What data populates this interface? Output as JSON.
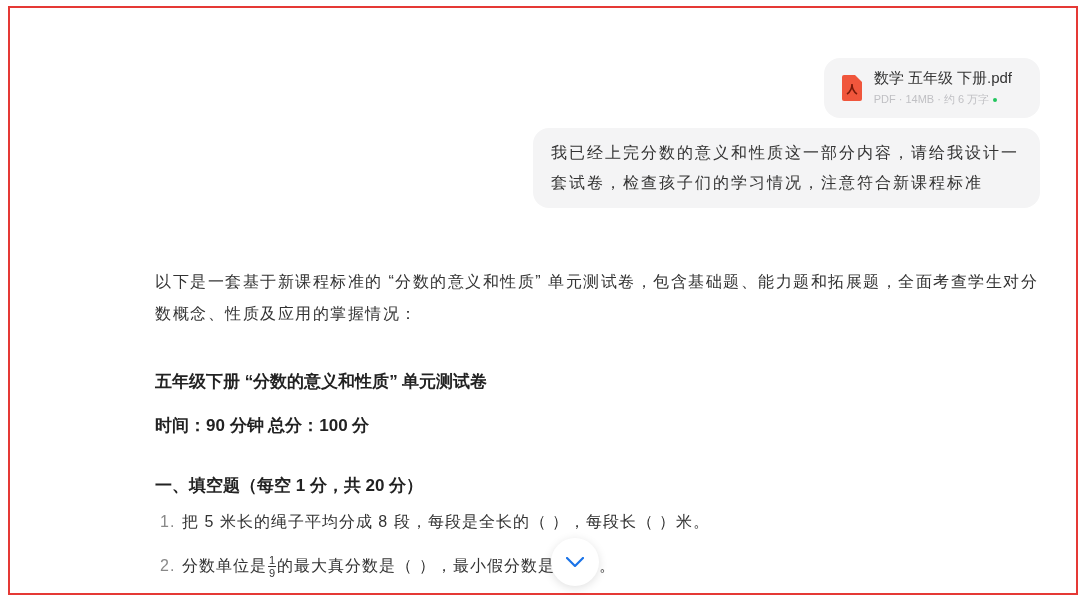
{
  "attachment": {
    "file_name": "数学 五年级 下册.pdf",
    "meta": "PDF · 14MB · 约 6 万字"
  },
  "user_message": "我已经上完分数的意义和性质这一部分内容，请给我设计一套试卷，检查孩子们的学习情况，注意符合新课程标准",
  "reply": {
    "intro": "以下是一套基于新课程标准的 “分数的意义和性质” 单元测试卷，包含基础题、能力题和拓展题，全面考查学生对分数概念、性质及应用的掌握情况：",
    "title": "五年级下册 “分数的意义和性质” 单元测试卷",
    "meta": "时间：90 分钟 总分：100 分",
    "section": "一、填空题（每空 1 分，共 20 分）",
    "items": [
      {
        "number": "1.",
        "before": "把 5 米长的绳子平均分成 8 段，每段是全长的（ ），每段长（ ）米。"
      },
      {
        "number": "2.",
        "before": "分数单位是",
        "fraction": {
          "numerator": "1",
          "denominator": "9"
        },
        "after": "的最大真分数是（ ），最小假分数是",
        "end": "。"
      }
    ]
  },
  "scroll_down_button": {
    "visible": true
  }
}
